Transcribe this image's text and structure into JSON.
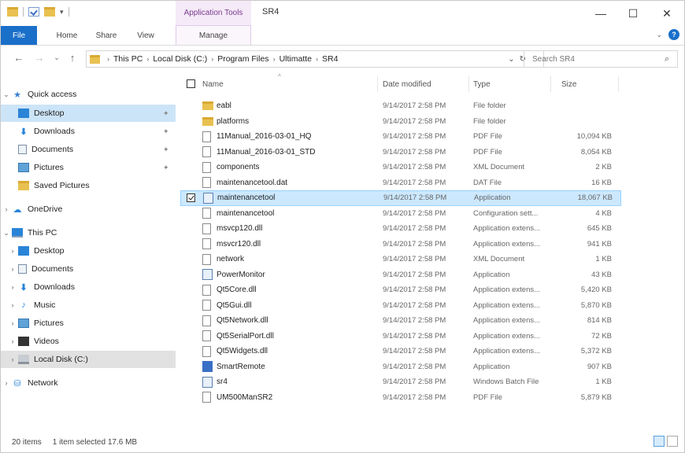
{
  "window": {
    "title": "SR4",
    "context_tab": "Application Tools",
    "controls": {
      "minimize": "—",
      "maximize": "☐",
      "close": "✕"
    }
  },
  "ribbon": {
    "tabs": [
      "File",
      "Home",
      "Share",
      "View",
      "Manage"
    ],
    "file_color": "#1a6fc9"
  },
  "address": {
    "crumbs": [
      "This PC",
      "Local Disk (C:)",
      "Program Files",
      "Ultimatte",
      "SR4"
    ]
  },
  "search": {
    "placeholder": "Search SR4"
  },
  "nav": {
    "quick_access": "Quick access",
    "items": [
      {
        "label": "Desktop",
        "icon": "desktop-icon",
        "pinned": true,
        "selected": true
      },
      {
        "label": "Downloads",
        "icon": "downloads-icon",
        "pinned": true
      },
      {
        "label": "Documents",
        "icon": "documents-icon",
        "pinned": true
      },
      {
        "label": "Pictures",
        "icon": "pictures-icon",
        "pinned": true
      },
      {
        "label": "Saved Pictures",
        "icon": "folder-icon"
      },
      {
        "label": "OneDrive",
        "icon": "onedrive-icon"
      },
      {
        "label": "This PC",
        "icon": "this-pc-icon"
      },
      {
        "label": "Desktop",
        "icon": "desktop-icon"
      },
      {
        "label": "Documents",
        "icon": "documents-icon"
      },
      {
        "label": "Downloads",
        "icon": "downloads-icon"
      },
      {
        "label": "Music",
        "icon": "music-icon"
      },
      {
        "label": "Pictures",
        "icon": "pictures-icon"
      },
      {
        "label": "Videos",
        "icon": "videos-icon"
      },
      {
        "label": "Local Disk (C:)",
        "icon": "local-disk-icon",
        "current": true
      },
      {
        "label": "Network",
        "icon": "network-icon"
      }
    ]
  },
  "columns": {
    "name": "Name",
    "date": "Date modified",
    "type": "Type",
    "size": "Size"
  },
  "files": [
    {
      "name": "eabl",
      "date": "9/14/2017 2:58 PM",
      "type": "File folder",
      "size": "",
      "icon": "folder"
    },
    {
      "name": "platforms",
      "date": "9/14/2017 2:58 PM",
      "type": "File folder",
      "size": "",
      "icon": "folder"
    },
    {
      "name": "11Manual_2016-03-01_HQ",
      "date": "9/14/2017 2:58 PM",
      "type": "PDF File",
      "size": "10,094 KB",
      "icon": "pdf"
    },
    {
      "name": "11Manual_2016-03-01_STD",
      "date": "9/14/2017 2:58 PM",
      "type": "PDF File",
      "size": "8,054 KB",
      "icon": "pdf"
    },
    {
      "name": "components",
      "date": "9/14/2017 2:58 PM",
      "type": "XML Document",
      "size": "2 KB",
      "icon": "xml"
    },
    {
      "name": "maintenancetool.dat",
      "date": "9/14/2017 2:58 PM",
      "type": "DAT File",
      "size": "16 KB",
      "icon": "file"
    },
    {
      "name": "maintenancetool",
      "date": "9/14/2017 2:58 PM",
      "type": "Application",
      "size": "18,067 KB",
      "icon": "app",
      "selected": true
    },
    {
      "name": "maintenancetool",
      "date": "9/14/2017 2:58 PM",
      "type": "Configuration sett...",
      "size": "4 KB",
      "icon": "config"
    },
    {
      "name": "msvcp120.dll",
      "date": "9/14/2017 2:58 PM",
      "type": "Application extens...",
      "size": "645 KB",
      "icon": "dll"
    },
    {
      "name": "msvcr120.dll",
      "date": "9/14/2017 2:58 PM",
      "type": "Application extens...",
      "size": "941 KB",
      "icon": "dll"
    },
    {
      "name": "network",
      "date": "9/14/2017 2:58 PM",
      "type": "XML Document",
      "size": "1 KB",
      "icon": "xml"
    },
    {
      "name": "PowerMonitor",
      "date": "9/14/2017 2:58 PM",
      "type": "Application",
      "size": "43 KB",
      "icon": "app"
    },
    {
      "name": "Qt5Core.dll",
      "date": "9/14/2017 2:58 PM",
      "type": "Application extens...",
      "size": "5,420 KB",
      "icon": "dll"
    },
    {
      "name": "Qt5Gui.dll",
      "date": "9/14/2017 2:58 PM",
      "type": "Application extens...",
      "size": "5,870 KB",
      "icon": "dll"
    },
    {
      "name": "Qt5Network.dll",
      "date": "9/14/2017 2:58 PM",
      "type": "Application extens...",
      "size": "814 KB",
      "icon": "dll"
    },
    {
      "name": "Qt5SerialPort.dll",
      "date": "9/14/2017 2:58 PM",
      "type": "Application extens...",
      "size": "72 KB",
      "icon": "dll"
    },
    {
      "name": "Qt5Widgets.dll",
      "date": "9/14/2017 2:58 PM",
      "type": "Application extens...",
      "size": "5,372 KB",
      "icon": "dll"
    },
    {
      "name": "SmartRemote",
      "date": "9/14/2017 2:58 PM",
      "type": "Application",
      "size": "907 KB",
      "icon": "app-blue"
    },
    {
      "name": "sr4",
      "date": "9/14/2017 2:58 PM",
      "type": "Windows Batch File",
      "size": "1 KB",
      "icon": "batch"
    },
    {
      "name": "UM500ManSR2",
      "date": "9/14/2017 2:58 PM",
      "type": "PDF File",
      "size": "5,879 KB",
      "icon": "pdf"
    }
  ],
  "status": {
    "count": "20 items",
    "selection": "1 item selected  17.6 MB"
  }
}
